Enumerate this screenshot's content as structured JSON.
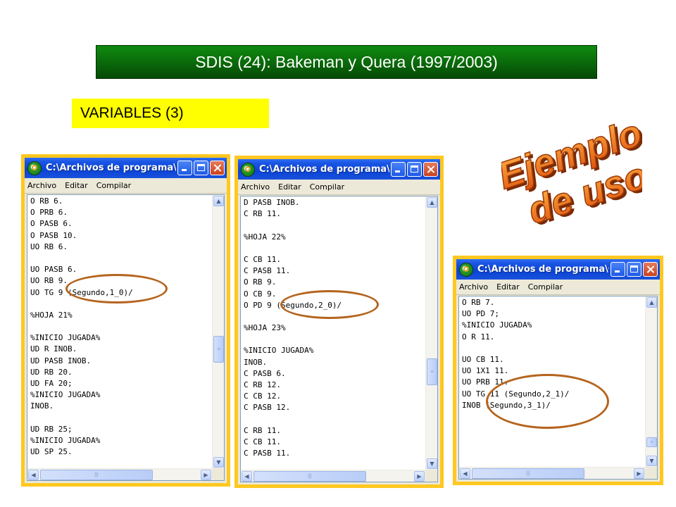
{
  "slide": {
    "title": "SDIS (24): Bakeman y Quera (1997/2003)",
    "subtitle": "VARIABLES (3)",
    "wordart_line1": "Ejemplo",
    "wordart_line2": "de uso"
  },
  "colors": {
    "frame": "#ffc820",
    "title_green": "#0b6e0b",
    "subtitle_yellow": "#ffff00",
    "wordart": "#e86a10",
    "oval": "#b5641e",
    "xp_titlebar": "#0b43d6"
  },
  "windows": [
    {
      "title": "C:\\Archivos de programa\\G...",
      "menu": [
        "Archivo",
        "Editar",
        "Compilar"
      ],
      "lines": [
        "O RB 6.",
        "O PRB 6.",
        "O PASB 6.",
        "O PASB 10.",
        "UO RB 6.",
        "",
        "UO PASB 6.",
        "UO RB 9.",
        "UO TG 9 (Segundo,1_0)/",
        "",
        "%HOJA 21%",
        "",
        "%INICIO JUGADA%",
        "UD R INOB.",
        "UD PASB INOB.",
        "UD RB 20.",
        "UD FA 20;",
        "%INICIO JUGADA%",
        "INOB.",
        "",
        "UD RB 25;",
        "%INICIO JUGADA%",
        "UD SP 25."
      ]
    },
    {
      "title": "C:\\Archivos de programa\\G...",
      "menu": [
        "Archivo",
        "Editar",
        "Compilar"
      ],
      "lines": [
        "D PASB INOB.",
        "C RB 11.",
        "",
        "%HOJA 22%",
        "",
        "C CB 11.",
        "C PASB 11.",
        "O RB 9.",
        "O CB 9.",
        "O PD 9 (Segundo,2_0)/",
        "",
        "%HOJA 23%",
        "",
        "%INICIO JUGADA%",
        "INOB.",
        "C PASB 6.",
        "C RB 12.",
        "C CB 12.",
        "C PASB 12.",
        "",
        "C RB 11.",
        "C CB 11.",
        "C PASB 11."
      ]
    },
    {
      "title": "C:\\Archivos de programa\\G...",
      "menu": [
        "Archivo",
        "Editar",
        "Compilar"
      ],
      "lines": [
        "O RB 7.",
        "UO PD 7;",
        "%INICIO JUGADA%",
        "O R 11.",
        "",
        "UO CB 11.",
        "UO 1X1 11.",
        "UO PRB 11.",
        "UO TG 11 (Segundo,2_1)/",
        "INOB (Segundo,3_1)/"
      ]
    }
  ]
}
